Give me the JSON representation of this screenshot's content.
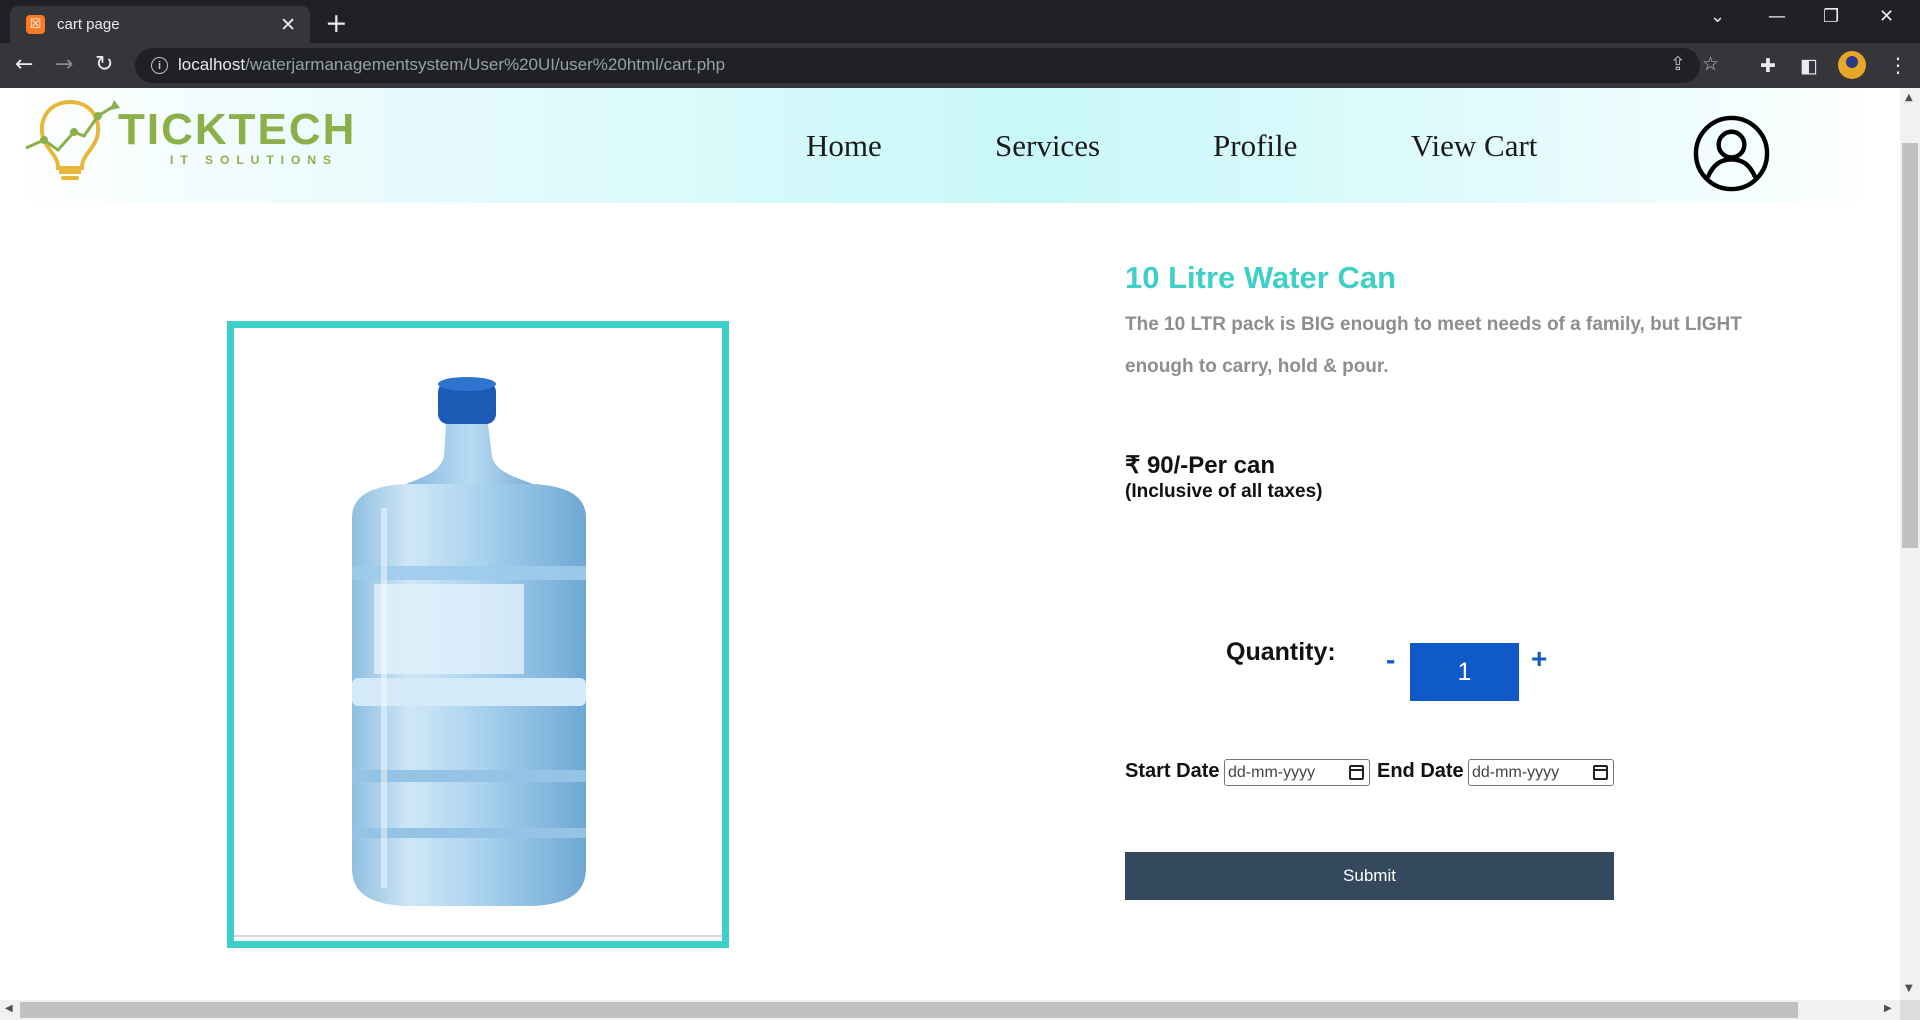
{
  "browser": {
    "tab_title": "cart page",
    "tab_favicon_glyph": "☒",
    "url_host": "localhost",
    "url_path": "/waterjarmanagementsystem/User%20UI/user%20html/cart.php",
    "icons": {
      "back": "back-arrow-icon",
      "forward": "forward-arrow-icon",
      "reload": "reload-icon",
      "share": "share-icon",
      "bookmark": "star-icon",
      "extensions": "puzzle-icon",
      "sidepanel": "side-panel-icon",
      "menu": "kebab-menu-icon"
    }
  },
  "site": {
    "logo_title": "TICKTECH",
    "logo_subtitle": "IT SOLUTIONS",
    "nav": [
      "Home",
      "Services",
      "Profile",
      "View Cart"
    ],
    "user_icon": "user-account-icon"
  },
  "product": {
    "title": "10 Litre Water Can",
    "description": "The 10 LTR pack is BIG enough to meet needs of a family, but LIGHT enough to carry, hold & pour.",
    "price": "₹ 90/-Per can",
    "tax_note": "(Inclusive of all taxes)",
    "image_alt": "water-can-image"
  },
  "order": {
    "quantity_label": "Quantity:",
    "minus": "-",
    "plus": "+",
    "quantity_value": "1",
    "start_date_label": "Start Date",
    "end_date_label": "End Date",
    "date_placeholder": "dd-mm-yyyy",
    "submit_label": "Submit"
  },
  "colors": {
    "accent": "#3ecfc9",
    "quantity_blue": "#0f59c9",
    "submit_bg": "#34495e",
    "logo_green": "#8bb04a",
    "logo_gold": "#e6b73a"
  }
}
